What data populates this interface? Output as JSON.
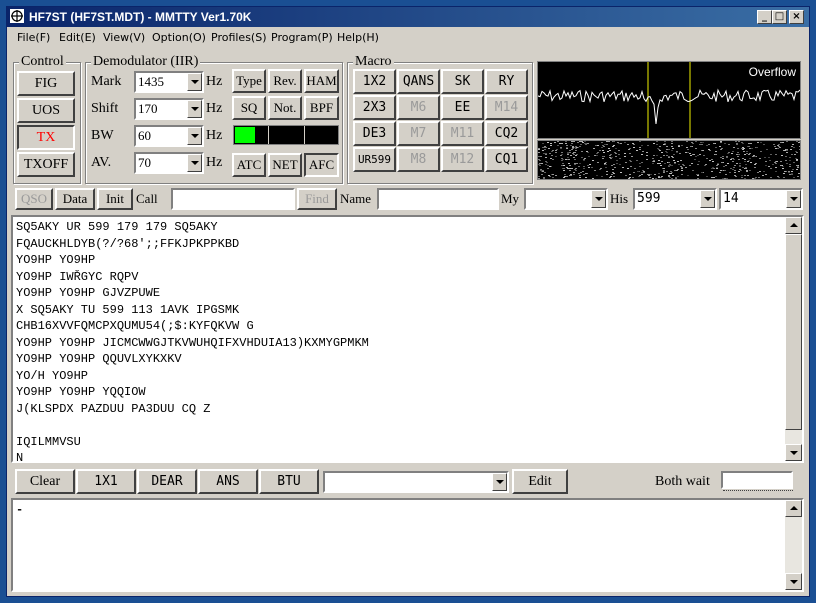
{
  "window": {
    "title": "HF7ST (HF7ST.MDT) - MMTTY Ver1.70K"
  },
  "title_buttons": {
    "minimize": "_",
    "maximize": "□",
    "close": "×"
  },
  "menu": [
    "File(F)",
    "Edit(E)",
    "View(V)",
    "Option(O)",
    "Profiles(S)",
    "Program(P)",
    "Help(H)"
  ],
  "control": {
    "label": "Control",
    "fig": "FIG",
    "uos": "UOS",
    "tx": "TX",
    "txoff": "TXOFF",
    "tx_color": "#ff0000"
  },
  "demod": {
    "label": "Demodulator (IIR)",
    "mark_label": "Mark",
    "mark_value": "1435",
    "shift_label": "Shift",
    "shift_value": "170",
    "bw_label": "BW",
    "bw_value": "60",
    "av_label": "AV.",
    "av_value": "70",
    "hz": "Hz",
    "type": "Type",
    "rev": "Rev.",
    "ham": "HAM",
    "sq": "SQ",
    "not": "Not.",
    "bpf": "BPF",
    "atc": "ATC",
    "net": "NET",
    "afc": "AFC",
    "level_color": "#00ff00"
  },
  "macro": {
    "label": "Macro",
    "buttons": [
      "1X2",
      "QANS",
      "SK",
      "RY",
      "2X3",
      "M6",
      "EE",
      "M14",
      "DE3",
      "M7",
      "M11",
      "CQ2",
      "UR599",
      "M8",
      "M12",
      "CQ1"
    ]
  },
  "spectrum": {
    "overflow": "Overflow",
    "marker_color": "#f0f000"
  },
  "qso_bar": {
    "qso": "QSO",
    "data": "Data",
    "init": "Init",
    "call": "Call",
    "call_value": "",
    "find": "Find",
    "name": "Name",
    "name_value": "",
    "my": "My",
    "my_value": "",
    "his": "His",
    "his_value": "599",
    "his2_value": "14"
  },
  "rx_text": [
    "SQ5AKY UR 599 179 179 SQ5AKY",
    "FQAUCKHLDYB(?/?68';;FFKJPKPPKBD",
    "YO9HP YO9HP",
    "YO9HP IWŘGYC RQPV",
    "YO9HP YO9HP GJVZPUWE",
    "X SQ5AKY TU 599 113 1AVK IPGSMK",
    "CHB16XVVFQMCPXQUMU54(;$:KYFQKVW G",
    "YO9HP YO9HP JICMCWWGJTKVWUHQIFXVHDUIA13)KXMYGPMKM",
    "YO9HP YO9HP QQUVLXYKXKV",
    "YO/H YO9HP",
    "YO9HP YO9HP YQQIOW",
    "J(KLSPDX PAZDUU PA3DUU CQ Z",
    "",
    "IQILMMVSU",
    "N_"
  ],
  "tx_bar": {
    "clear": "Clear",
    "b1x1": "1X1",
    "dear": "DEAR",
    "ans": "ANS",
    "btu": "BTU",
    "select_value": "",
    "edit": "Edit",
    "both_wait": "Both wait"
  },
  "tx_text": "-"
}
